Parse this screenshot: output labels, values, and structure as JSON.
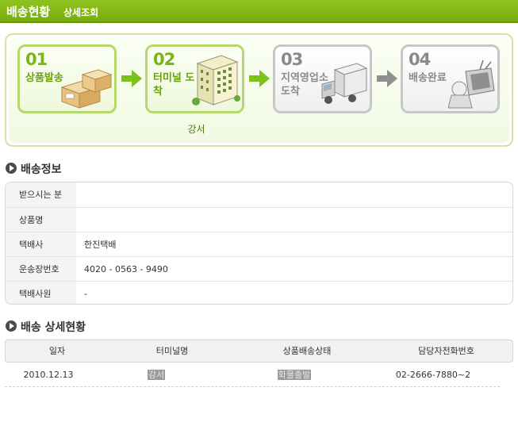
{
  "header": {
    "title": "배송현황",
    "subtitle": "상세조회"
  },
  "steps": [
    {
      "num": "01",
      "label": "상품발송",
      "active": true
    },
    {
      "num": "02",
      "label": "터미널 도착",
      "active": true,
      "sub": "강서"
    },
    {
      "num": "03",
      "label": "지역영업소 도착",
      "active": false
    },
    {
      "num": "04",
      "label": "배송완료",
      "active": false
    }
  ],
  "info_section": {
    "title": "배송정보",
    "rows": [
      {
        "key": "받으시는 분",
        "value": ""
      },
      {
        "key": "상품명",
        "value": ""
      },
      {
        "key": "택배사",
        "value": "한진택배"
      },
      {
        "key": "운송장번호",
        "value": "4020 - 0563 - 9490"
      },
      {
        "key": "택배사원",
        "value": "-"
      }
    ]
  },
  "detail_section": {
    "title": "배송 상세현황",
    "columns": [
      "일자",
      "터미널명",
      "상품배송상태",
      "담당자전화번호"
    ],
    "rows": [
      {
        "date": "2010.12.13",
        "terminal": "강서",
        "status": "화물출발",
        "phone": "02-2666-7880~2"
      }
    ]
  },
  "colors": {
    "accent": "#8fc31f",
    "active_text": "#6da20f",
    "inactive_text": "#8a8a8a"
  }
}
